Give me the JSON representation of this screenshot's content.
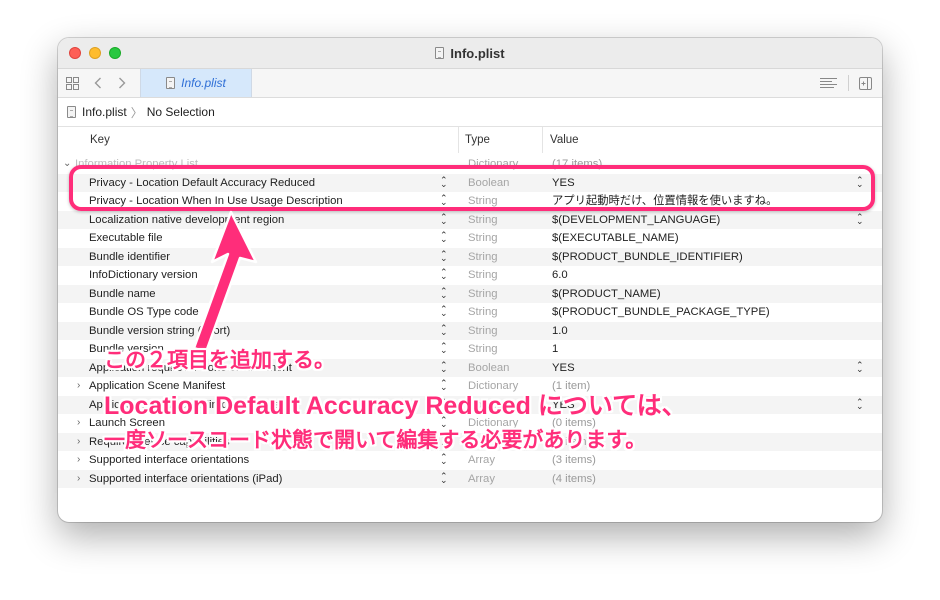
{
  "window": {
    "title": "Info.plist"
  },
  "toolbar": {
    "grid_icon": "grid-icon",
    "back_icon": "chevron-left-icon",
    "forward_icon": "chevron-right-icon",
    "tab_label": "Info.plist",
    "lines_icon": "lines-icon",
    "inspector_icon": "add-editor-icon"
  },
  "jumpbar": {
    "file": "Info.plist",
    "selection": "No Selection"
  },
  "columns": {
    "key": "Key",
    "type": "Type",
    "value": "Value"
  },
  "rows": [
    {
      "key": "Information Property List",
      "type": "Dictionary",
      "value": "(17 items)",
      "faded": true
    },
    {
      "key": "Privacy - Location Default Accuracy Reduced",
      "type": "Boolean",
      "value": "YES"
    },
    {
      "key": "Privacy - Location When In Use Usage Description",
      "type": "String",
      "value": "アプリ起動時だけ、位置情報を使いますね。"
    },
    {
      "key": "Localization native development region",
      "type": "String",
      "value": "$(DEVELOPMENT_LANGUAGE)"
    },
    {
      "key": "Executable file",
      "type": "String",
      "value": "$(EXECUTABLE_NAME)"
    },
    {
      "key": "Bundle identifier",
      "type": "String",
      "value": "$(PRODUCT_BUNDLE_IDENTIFIER)"
    },
    {
      "key": "InfoDictionary version",
      "type": "String",
      "value": "6.0"
    },
    {
      "key": "Bundle name",
      "type": "String",
      "value": "$(PRODUCT_NAME)"
    },
    {
      "key": "Bundle OS Type code",
      "type": "String",
      "value": "$(PRODUCT_BUNDLE_PACKAGE_TYPE)"
    },
    {
      "key": "Bundle version string (short)",
      "type": "String",
      "value": "1.0"
    },
    {
      "key": "Bundle version",
      "type": "String",
      "value": "1"
    },
    {
      "key": "Application requires iPhone environment",
      "type": "Boolean",
      "value": "YES"
    },
    {
      "key": "Application Scene Manifest",
      "type": "Dictionary",
      "value": "(1 item)"
    },
    {
      "key": "Application supports indirect input events",
      "type": "Boolean",
      "value": "YES"
    },
    {
      "key": "Launch Screen",
      "type": "Dictionary",
      "value": "(0 items)"
    },
    {
      "key": "Required device capabilities",
      "type": "Array",
      "value": "(1 item)"
    },
    {
      "key": "Supported interface orientations",
      "type": "Array",
      "value": "(3 items)"
    },
    {
      "key": "Supported interface orientations (iPad)",
      "type": "Array",
      "value": "(4 items)"
    }
  ],
  "annotation": {
    "line1": "この２項目を追加する。",
    "line2": "Location Default Accuracy Reduced については、",
    "line3": "一度ソースコード状態で開いて編集する必要があります。",
    "color": "#ff2d7a"
  }
}
